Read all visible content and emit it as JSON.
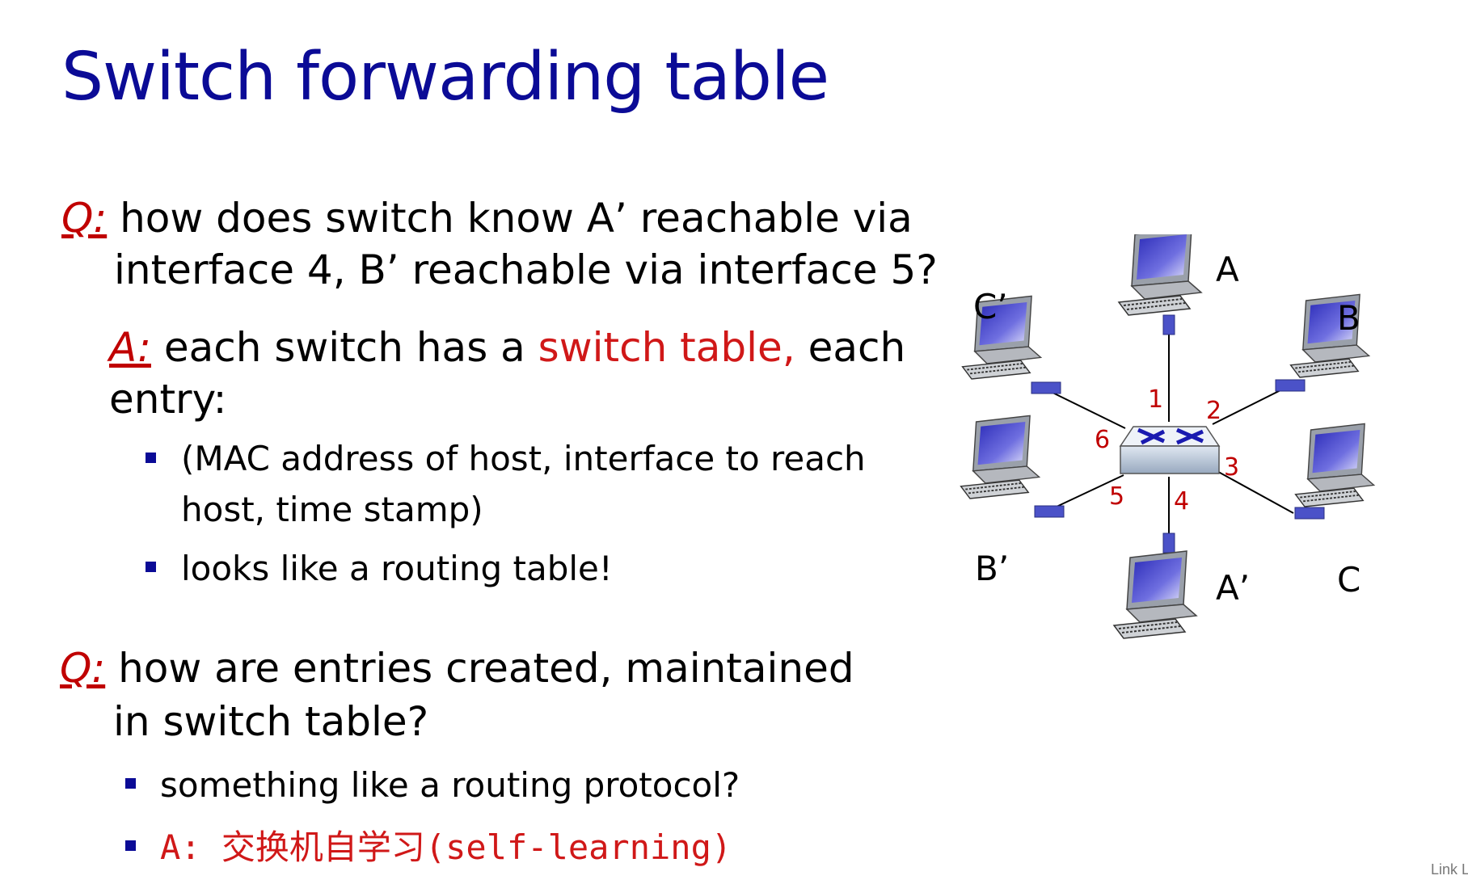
{
  "title": "Switch forwarding table",
  "q1": {
    "label": "Q:",
    "line1": " how does switch know A’ reachable via",
    "line2": "interface 4, B’ reachable via interface 5?"
  },
  "a1": {
    "label": "A:",
    "pre": "  each switch has a ",
    "highlight": "switch table,",
    "post": " each",
    "line2": "entry:"
  },
  "bullets1": [
    {
      "line1": "(MAC address of host, interface to reach",
      "line2": "host, time stamp)"
    },
    {
      "line1": "looks like a routing table!"
    }
  ],
  "q2": {
    "label": "Q:",
    "line1": " how are entries created, maintained",
    "line2": "in switch table?"
  },
  "bullets2": [
    {
      "text": "something like a routing protocol?"
    },
    {
      "text": "A: 交换机自学习(self-learning)"
    }
  ],
  "footer": "Link L",
  "diagram": {
    "hosts": [
      "A",
      "B",
      "C",
      "A’",
      "B’",
      "C’"
    ],
    "interfaces": [
      "1",
      "2",
      "3",
      "4",
      "5",
      "6"
    ],
    "colors": {
      "link": "#000000",
      "interface_label": "#c00000",
      "nic": "#4b52c8",
      "switch": "#b9c7d8",
      "screen": "#4646c8"
    }
  }
}
